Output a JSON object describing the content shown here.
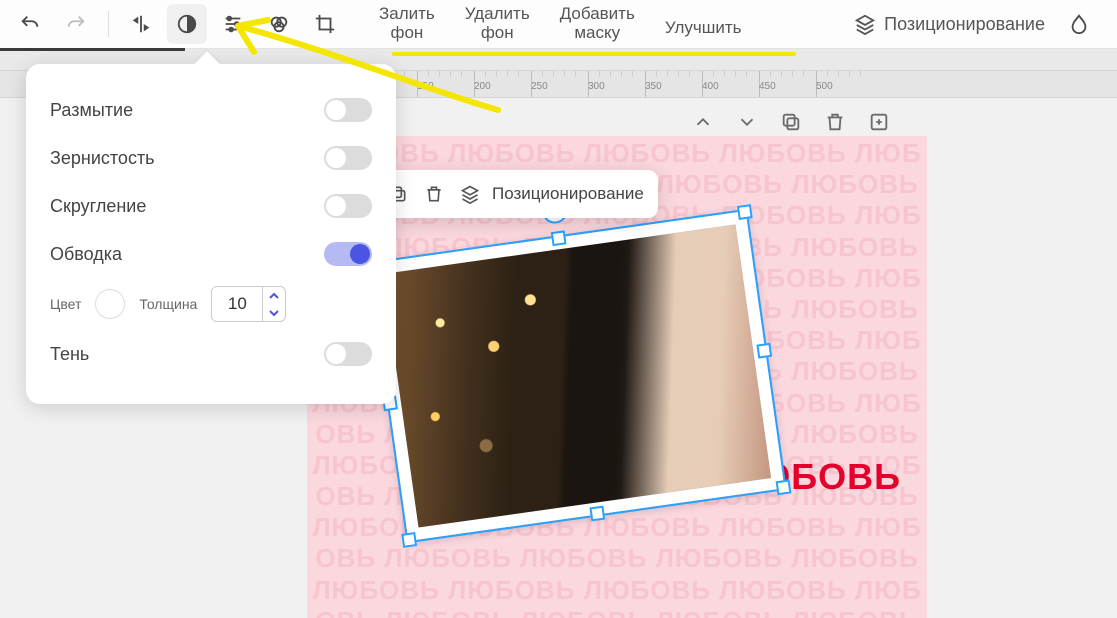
{
  "toolbar": {
    "text_buttons": [
      {
        "label": "Залить\nфон"
      },
      {
        "label": "Удалить\nфон"
      },
      {
        "label": "Добавить\nмаску"
      },
      {
        "label": "Улучшить"
      }
    ],
    "positioning_label": "Позиционирование"
  },
  "ruler": {
    "start": 100,
    "step": 50,
    "count": 9
  },
  "panel": {
    "items": [
      {
        "label": "Размытие",
        "on": false
      },
      {
        "label": "Зернистость",
        "on": false
      },
      {
        "label": "Скругление",
        "on": false
      },
      {
        "label": "Обводка",
        "on": true
      },
      {
        "label": "Тень",
        "on": false
      }
    ],
    "color_label": "Цвет",
    "color_value": "#ffffff",
    "thickness_label": "Толщина",
    "thickness_value": "10"
  },
  "inner_toolbar": {
    "positioning_label": "Позиционирование"
  },
  "canvas": {
    "bg_word": "ЛЮБОВЬ",
    "accent_word": "ЛЮБОВЬ"
  }
}
